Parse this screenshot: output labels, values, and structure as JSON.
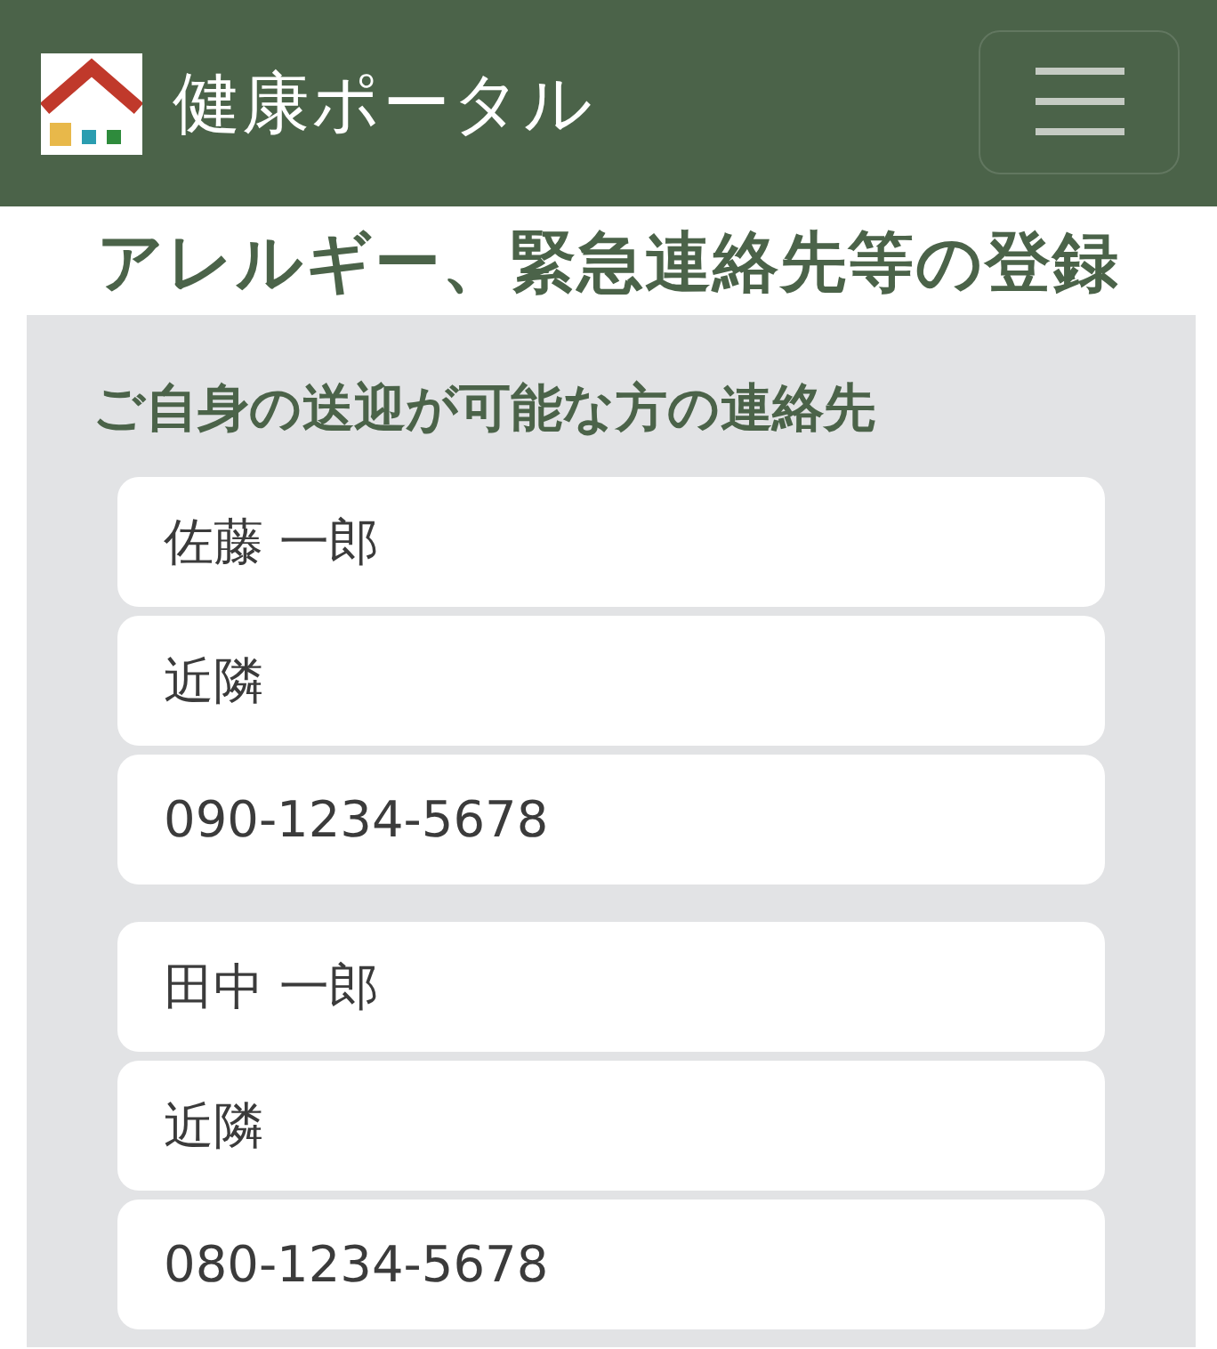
{
  "header": {
    "brand": "健康ポータル"
  },
  "page_title": "アレルギー、緊急連絡先等の登録",
  "section": {
    "heading": "ご自身の送迎が可能な方の連絡先",
    "contacts": [
      {
        "name": "佐藤 一郎",
        "relationship": "近隣",
        "phone": "090-1234-5678"
      },
      {
        "name": "田中 一郎",
        "relationship": "近隣",
        "phone": "080-1234-5678"
      }
    ]
  }
}
